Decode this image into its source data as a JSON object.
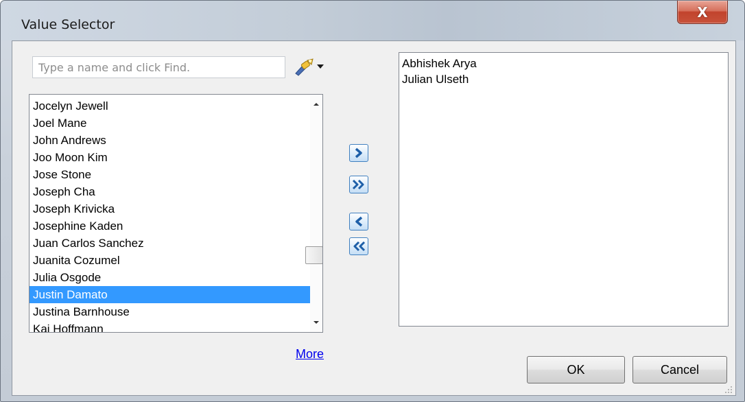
{
  "window": {
    "title": "Value Selector",
    "close_glyph": "X"
  },
  "search": {
    "placeholder": "Type a name and click Find.",
    "value": "",
    "find_icon": "find-people-icon"
  },
  "available_list": {
    "items": [
      "Jocelyn Jewell",
      "Joel Mane",
      "John Andrews",
      "Joo Moon Kim",
      "Jose Stone",
      "Joseph Cha",
      "Joseph Krivicka",
      "Josephine Kaden",
      "Juan Carlos Sanchez",
      "Juanita Cozumel",
      "Julia Osgode",
      "Justin Damato",
      "Justina Barnhouse",
      "Kai Hoffmann"
    ],
    "selected": "Justin Damato"
  },
  "move_buttons": {
    "add": "chevron-right-icon",
    "add_all": "double-chevron-right-icon",
    "remove": "chevron-left-icon",
    "remove_all": "double-chevron-left-icon"
  },
  "selected_list": {
    "items": [
      "Abhishek Arya",
      "Julian Ulseth"
    ]
  },
  "footer": {
    "more_label": "More",
    "ok_label": "OK",
    "cancel_label": "Cancel"
  },
  "colors": {
    "selection": "#3399ff",
    "close_button": "#c8523b",
    "link": "#0000ee"
  }
}
